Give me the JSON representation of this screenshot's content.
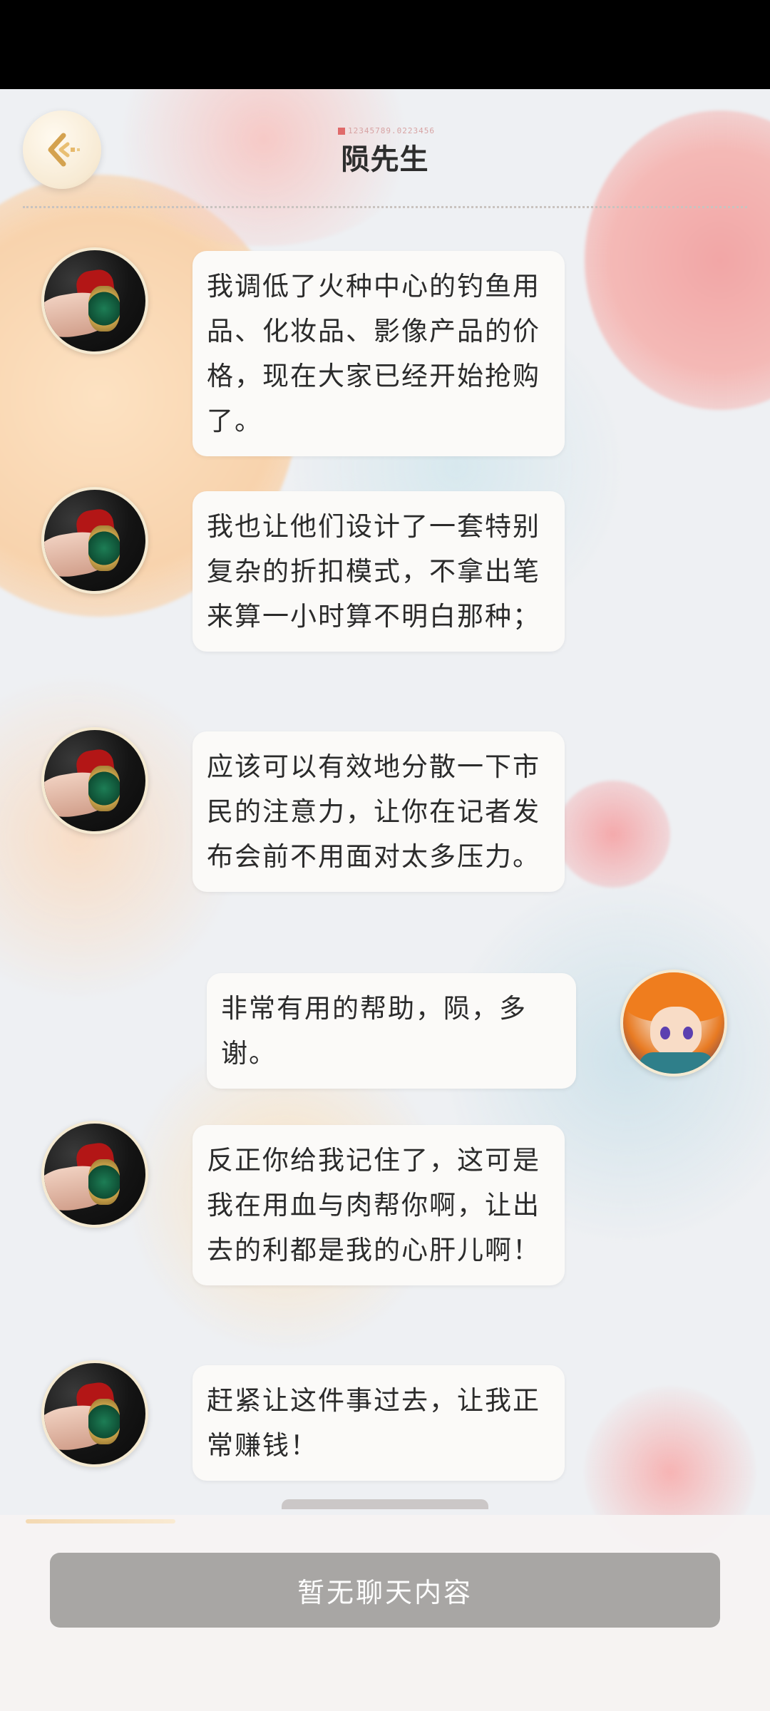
{
  "header": {
    "title": "陨先生",
    "subtext": "12345789.0223456"
  },
  "icons": {
    "back": "chevron-left-icon"
  },
  "colors": {
    "bubble_bg": "#fbfaf8",
    "button_bg": "#a8a6a4",
    "accent": "#f4d9b2"
  },
  "messages": [
    {
      "sender": "npc",
      "text": "我调低了火种中心的钓鱼用品、化妆品、影像产品的价格，现在大家已经开始抢购了。"
    },
    {
      "sender": "npc",
      "text": "我也让他们设计了一套特别复杂的折扣模式，不拿出笔来算一小时算不明白那种；"
    },
    {
      "sender": "npc",
      "text": "应该可以有效地分散一下市民的注意力，让你在记者发布会前不用面对太多压力。"
    },
    {
      "sender": "player",
      "text": "非常有用的帮助，陨，多谢。"
    },
    {
      "sender": "npc",
      "text": "反正你给我记住了，这可是我在用血与肉帮你啊，让出去的利都是我的心肝儿啊！"
    },
    {
      "sender": "npc",
      "text": "赶紧让这件事过去，让我正常赚钱！"
    }
  ],
  "footer": {
    "empty_chat_label": "暂无聊天内容"
  }
}
